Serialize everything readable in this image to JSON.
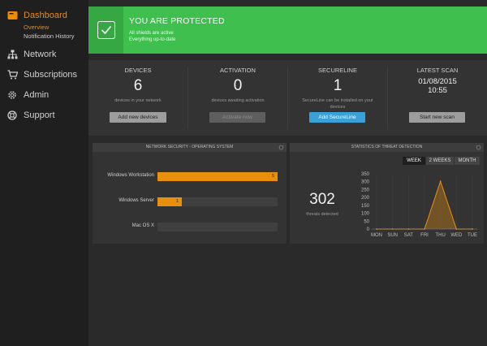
{
  "sidebar": {
    "items": [
      {
        "label": "Dashboard",
        "icon": "dashboard-icon"
      },
      {
        "label": "Network",
        "icon": "network-icon"
      },
      {
        "label": "Subscriptions",
        "icon": "cart-icon"
      },
      {
        "label": "Admin",
        "icon": "gear-icon"
      },
      {
        "label": "Support",
        "icon": "lifebuoy-icon"
      }
    ],
    "subitems": [
      {
        "label": "Overview"
      },
      {
        "label": "Notification History"
      }
    ]
  },
  "banner": {
    "title": "YOU ARE PROTECTED",
    "line1": "All shields are active",
    "line2": "Everything up-to-date",
    "color": "#3fbf4e"
  },
  "stats": {
    "devices": {
      "title": "DEVICES",
      "value": "6",
      "sub": "devices in your network",
      "button": "Add new devices"
    },
    "activation": {
      "title": "ACTIVATION",
      "value": "0",
      "sub": "devices awaiting activation",
      "button": "Activate now"
    },
    "secureline": {
      "title": "SECURELINE",
      "value": "1",
      "sub1": "SecureLine can be installed on your",
      "sub2": "devices",
      "button": "Add SecureLine"
    },
    "lastscan": {
      "title": "LATEST SCAN",
      "date": "01/08/2015",
      "time": "10:55",
      "button": "Start new scan"
    }
  },
  "network_panel": {
    "title": "NETWORK SECURITY - OPERATING SYSTEM",
    "chart_data": {
      "type": "bar",
      "categories": [
        "Windows Workstation",
        "Windows Server",
        "Mac OS X"
      ],
      "values": [
        5,
        1,
        0
      ],
      "labels": [
        "5",
        "1",
        ""
      ],
      "xlim": [
        0,
        5
      ],
      "color": "#e8900d"
    }
  },
  "threat_panel": {
    "title": "STATISTICS OF THREAT DETECTION",
    "count": "302",
    "count_label": "threats detected",
    "ranges": [
      "WEEK",
      "2 WEEKS",
      "MONTH"
    ],
    "selected_range": "WEEK",
    "chart_data": {
      "type": "area",
      "categories": [
        "MON",
        "SUN",
        "SAT",
        "FRI",
        "THU",
        "WED",
        "TUE"
      ],
      "values": [
        0,
        0,
        0,
        0,
        302,
        0,
        0
      ],
      "ylim": [
        0,
        350
      ],
      "yticks": [
        0,
        50,
        100,
        150,
        200,
        250,
        300,
        350
      ],
      "color": "#e8900d"
    }
  }
}
